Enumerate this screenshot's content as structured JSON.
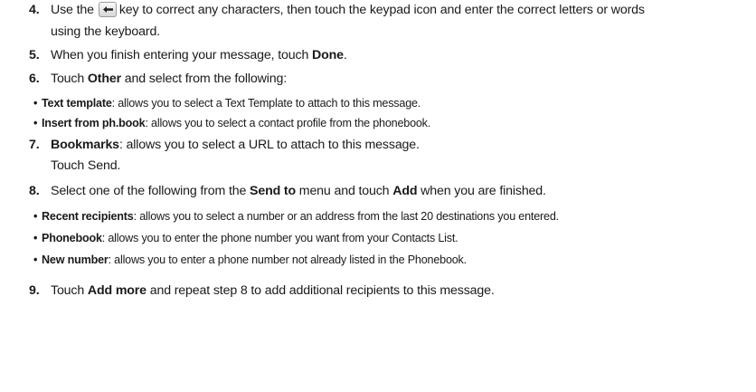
{
  "steps": [
    {
      "number": "4.",
      "line1_a": "Use the",
      "key_icon": "backspace-arrow-icon",
      "line1_b": "key to correct any characters, then touch the keypad icon and enter the correct letters or words",
      "line2": "using the keyboard."
    },
    {
      "number": "5.",
      "text_a": "When you finish entering your message, touch ",
      "bold": "Done",
      "text_b": "."
    },
    {
      "number": "6.",
      "text_a": "Touch ",
      "bold": "Other",
      "text_b": " and select from the following:",
      "bullets": [
        {
          "term": "Text template",
          "desc": ": allows you to select a Text Template to attach to this message."
        },
        {
          "term": "Insert from ph.book",
          "desc": ": allows you to select a contact profile from the phonebook."
        }
      ]
    },
    {
      "number": "7.",
      "bold": "Bookmarks",
      "text_b": ": allows you to select a URL to attach to this message.",
      "line2": "Touch Send."
    },
    {
      "number": "8.",
      "text_a": "Select one of the following from the ",
      "bold1": "Send to",
      "text_mid": " menu and touch ",
      "bold2": "Add",
      "text_b": " when you are finished.",
      "bullets": [
        {
          "term": "Recent recipients",
          "desc": ": allows you to select a number or an address from the last 20 destinations you entered."
        },
        {
          "term": "Phonebook",
          "desc": ": allows you to enter the phone number you want from your Contacts List."
        },
        {
          "term": "New number",
          "desc": ": allows you to enter a phone number not already listed in the Phonebook."
        }
      ]
    },
    {
      "number": "9.",
      "text_a": "Touch ",
      "bold": "Add more",
      "text_b": " and repeat step 8 to add additional recipients to this message."
    }
  ]
}
